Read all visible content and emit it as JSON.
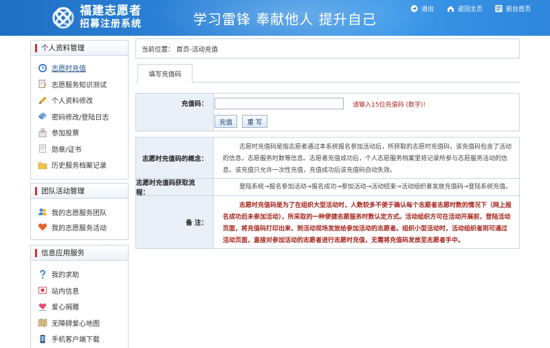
{
  "header": {
    "logo_line1": "福建志愿者",
    "logo_line2": "招募注册系统",
    "slogan": "学习雷锋  奉献他人  提升自己",
    "nav": [
      {
        "label": "退出",
        "icon": "logout-icon"
      },
      {
        "label": "返回主页",
        "icon": "home-icon"
      },
      {
        "label": "前台首页",
        "icon": "front-page-icon"
      }
    ]
  },
  "sidebar": {
    "sections": [
      {
        "title": "个人资料管理",
        "items": [
          {
            "label": "志愿时充值",
            "icon": "clock-icon",
            "active": true
          },
          {
            "label": "志愿服务知识测试",
            "icon": "document-pencil-icon"
          },
          {
            "label": "个人资料修改",
            "icon": "pencil-icon"
          },
          {
            "label": "密码修改/登陆日志",
            "icon": "key-icon"
          },
          {
            "label": "参加投票",
            "icon": "vote-icon"
          },
          {
            "label": "勋章/证书",
            "icon": "certificate-icon"
          },
          {
            "label": "历史服务档案记录",
            "icon": "folder-icon"
          }
        ]
      },
      {
        "title": "团队活动管理",
        "items": [
          {
            "label": "我的志愿服务团队",
            "icon": "team-icon"
          },
          {
            "label": "我的志愿服务活动",
            "icon": "heart-icon"
          }
        ]
      },
      {
        "title": "信息应用服务",
        "items": [
          {
            "label": "我的求助",
            "icon": "help-icon"
          },
          {
            "label": "站内信息",
            "icon": "message-icon"
          },
          {
            "label": "爱心捐赠",
            "icon": "donate-icon"
          },
          {
            "label": "无障碍爱心地图",
            "icon": "map-icon"
          },
          {
            "label": "手机客户端下载",
            "icon": "phone-icon"
          }
        ]
      }
    ]
  },
  "breadcrumb": "当前位置： 首页-活动充值",
  "tab_label": "填写充值码",
  "form": {
    "code_label": "充值码：",
    "code_value": "",
    "hint": "请输入15位充值码 (数字)!",
    "submit_label": "充值",
    "reset_label": "重 写"
  },
  "info": {
    "concept_label": "志愿时充值码的概念：",
    "concept_text": "志愿时充值码是指志愿者通过本系统报名参加活动后，所获取的志愿时充值码，该充值码包含了活动的信息，志愿服务时数等信息。志愿者充值成功后，个人志愿服务档案里将记录所参与志愿服务活动的信息。该充值只允许一次性充值，充值成功后该充值码自动失效。",
    "process_label": "志愿时充值码获取流程：",
    "process_text": "登陆系统→报名参加活动→报名成功→参加活动→活动结束→活动组织者发放充值码→登陆系统充值。",
    "note_label": "备 注：",
    "note_text": "志愿时充值码是为了在组织大型活动时，人数较多不便于确认每个志愿者志愿时数的情况下（网上报名成功后未参加活动），所采取的一种便捷志愿服务时数认定方式。活动组织方可在活动开展前，登陆活动页面，将充值码打印出来，到活动现场发放给参加活动的志愿者。组织小型活动时，活动组织者则可通过活动页面，直接对参加活动的志愿者进行志愿时充值，无需将充值码发放至志愿者手中。"
  }
}
